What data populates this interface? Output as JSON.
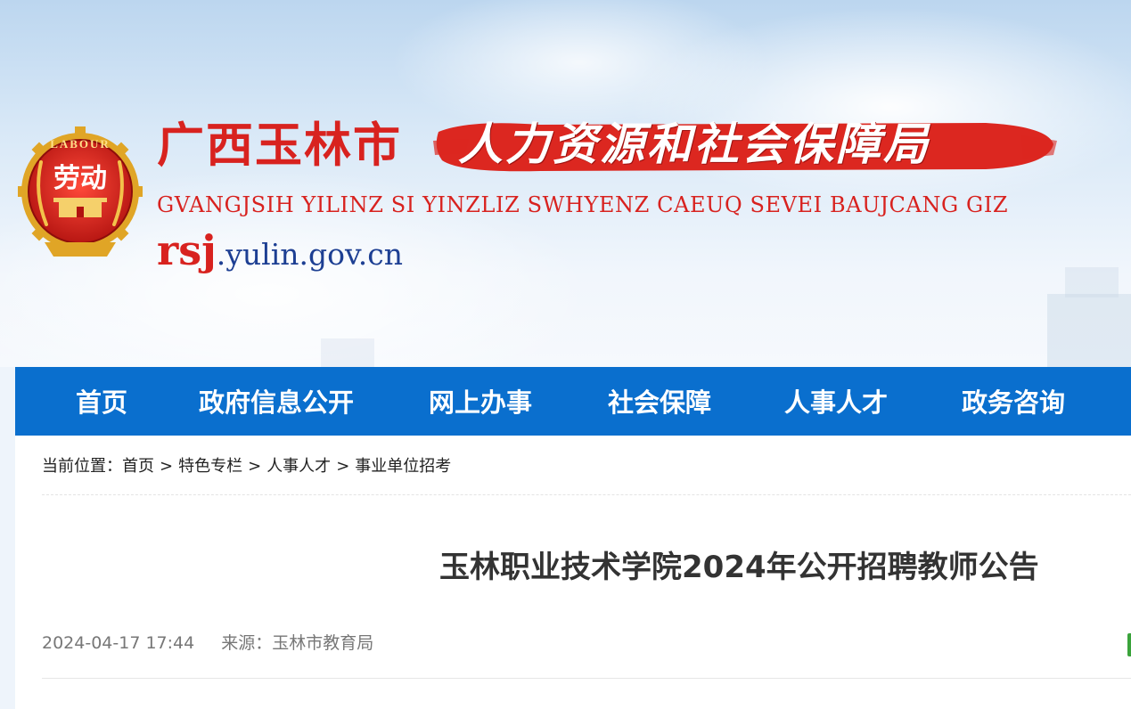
{
  "header": {
    "site_name": "广西玉林市",
    "dept_name": "人力资源和社会保障局",
    "zhuang_name": "GVANGJSIH YILINZ SI YINZLIZ SWHYENZ CAEUQ SEVEI BAUJCANG GIZ",
    "domain_prefix": "rsj",
    "domain_suffix": ".yulin.gov.cn",
    "emblem_text": "劳动",
    "emblem_ring_text": "LABOUR",
    "brand_color": "#d8221f",
    "domain_color": "#1d3f93"
  },
  "nav": {
    "background": "#0a6fce",
    "items": [
      {
        "label": "首页"
      },
      {
        "label": "政府信息公开"
      },
      {
        "label": "网上办事"
      },
      {
        "label": "社会保障"
      },
      {
        "label": "人事人才"
      },
      {
        "label": "政务咨询"
      }
    ]
  },
  "breadcrumb": {
    "prefix": "当前位置：",
    "items": [
      "首页",
      "特色专栏",
      "人事人才",
      "事业单位招考"
    ],
    "separator": ">"
  },
  "article": {
    "title": "玉林职业技术学院2024年公开招聘教师公告",
    "date": "2024-04-17 17:44",
    "source_label": "来源：",
    "source": "玉林市教育局"
  }
}
